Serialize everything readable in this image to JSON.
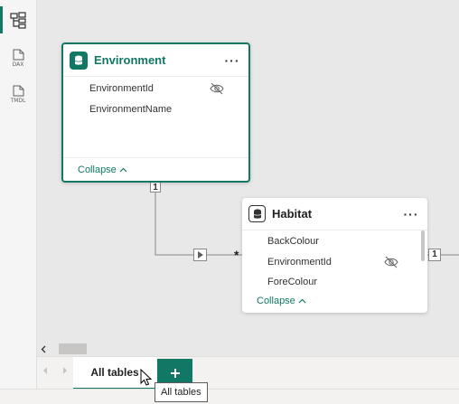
{
  "tables": [
    {
      "name": "Environment",
      "fields": [
        {
          "name": "EnvironmentId",
          "hidden": true
        },
        {
          "name": "EnvironmentName",
          "hidden": false
        }
      ],
      "collapse_label": "Collapse",
      "more_label": "···",
      "icon": "table-icon",
      "selected": true
    },
    {
      "name": "Habitat",
      "fields": [
        {
          "name": "BackColour",
          "hidden": false
        },
        {
          "name": "EnvironmentId",
          "hidden": true
        },
        {
          "name": "ForeColour",
          "hidden": false
        }
      ],
      "collapse_label": "Collapse",
      "more_label": "···",
      "icon": "table-icon",
      "selected": false
    }
  ],
  "relationships": [
    {
      "from": "Environment",
      "to": "Habitat",
      "from_card": "1",
      "to_card": "*"
    }
  ],
  "offscreen_badge": "1",
  "left_rail": {
    "items": [
      {
        "id": "model",
        "icon": "model-diagram-icon",
        "active": true
      },
      {
        "id": "dax",
        "icon": "dax-query-icon",
        "label": "DAX",
        "active": false
      },
      {
        "id": "tmdl",
        "icon": "tmdl-icon",
        "label": "TMDL",
        "active": false
      }
    ]
  },
  "tabs": {
    "active_label": "All tables",
    "add_label": "+",
    "tooltip": "All tables"
  },
  "colors": {
    "accent": "#117865",
    "canvas": "#e8e8e8"
  }
}
